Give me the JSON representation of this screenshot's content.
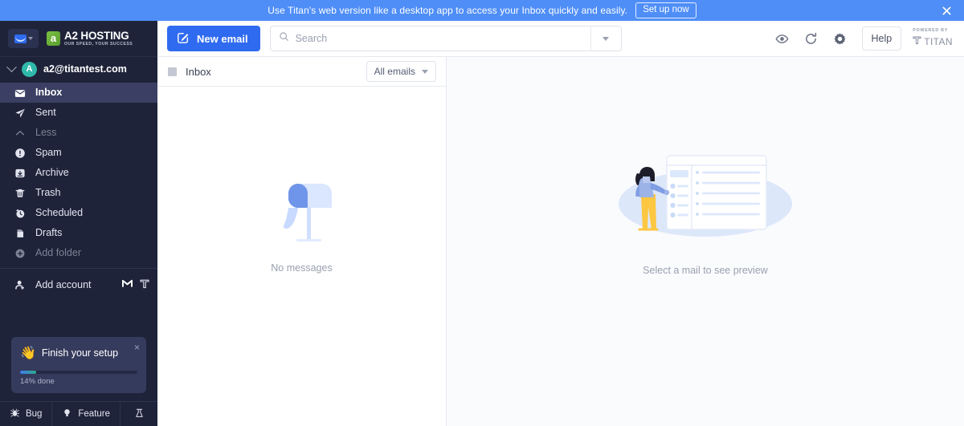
{
  "banner": {
    "text": "Use Titan's web version like a desktop app to access your Inbox quickly and easily.",
    "cta_label": "Set up now",
    "close_icon": "close-icon",
    "bg_color": "#4f8ef7"
  },
  "sidebar": {
    "mail_switcher_icon": "mail-envelope-icon",
    "brand": {
      "mark": "a2-logo-mark",
      "name": "A2 HOSTING",
      "tagline": "OUR SPEED, YOUR SUCCESS",
      "mark_color": "#7ac143"
    },
    "account": {
      "avatar_letter": "A",
      "avatar_color": "#2fb9ab",
      "email": "a2@titantest.com",
      "expand_icon": "chevron-down-icon"
    },
    "nav_items": [
      {
        "label": "Inbox",
        "icon": "inbox-envelope-icon",
        "state": "active"
      },
      {
        "label": "Sent",
        "icon": "send-paper-plane-icon",
        "state": "normal"
      },
      {
        "label": "Less",
        "icon": "chevron-up-icon",
        "state": "muted"
      },
      {
        "label": "Spam",
        "icon": "spam-alert-icon",
        "state": "normal"
      },
      {
        "label": "Archive",
        "icon": "archive-box-icon",
        "state": "normal"
      },
      {
        "label": "Trash",
        "icon": "trash-bin-icon",
        "state": "normal"
      },
      {
        "label": "Scheduled",
        "icon": "scheduled-clock-icon",
        "state": "normal"
      },
      {
        "label": "Drafts",
        "icon": "drafts-file-icon",
        "state": "normal"
      },
      {
        "label": "Add folder",
        "icon": "add-folder-plus-icon",
        "state": "muted"
      }
    ],
    "add_account": {
      "label": "Add account",
      "icon": "add-person-icon",
      "provider_icons": [
        "gmail-m-icon",
        "titan-shield-icon"
      ]
    },
    "setup_card": {
      "emoji": "👋",
      "title": "Finish your setup",
      "progress_label": "14% done",
      "progress_percent": 14,
      "close_icon": "close-icon",
      "fill_start_color": "#3f7ef0",
      "fill_end_color": "#2ea98a"
    },
    "footer_buttons": [
      {
        "label": "Bug",
        "icon": "bug-icon"
      },
      {
        "label": "Feature",
        "icon": "lightbulb-icon"
      },
      {
        "label": "",
        "icon": "flask-lab-icon"
      }
    ]
  },
  "toolbar": {
    "new_email_label": "New email",
    "new_email_icon": "compose-pencil-icon",
    "search_placeholder": "Search",
    "search_value": "",
    "search_icon": "search-icon",
    "search_dropdown_icon": "chevron-down-icon",
    "icons": [
      {
        "name": "eye-icon"
      },
      {
        "name": "refresh-icon"
      },
      {
        "name": "gear-icon"
      }
    ],
    "help_label": "Help",
    "powered_by_top": "POWERED BY",
    "powered_by_name": "TITAN",
    "powered_by_icon": "titan-shield-icon",
    "accent_color": "#2f6bf0"
  },
  "list_pane": {
    "select_all_checkbox": "unchecked",
    "title": "Inbox",
    "filter_label": "All emails",
    "filter_icon": "chevron-down-icon",
    "empty_illustration": "mailbox-illustration",
    "empty_text": "No messages"
  },
  "preview_pane": {
    "illustration": "person-selecting-mail-illustration",
    "empty_text": "Select a mail to see preview"
  }
}
